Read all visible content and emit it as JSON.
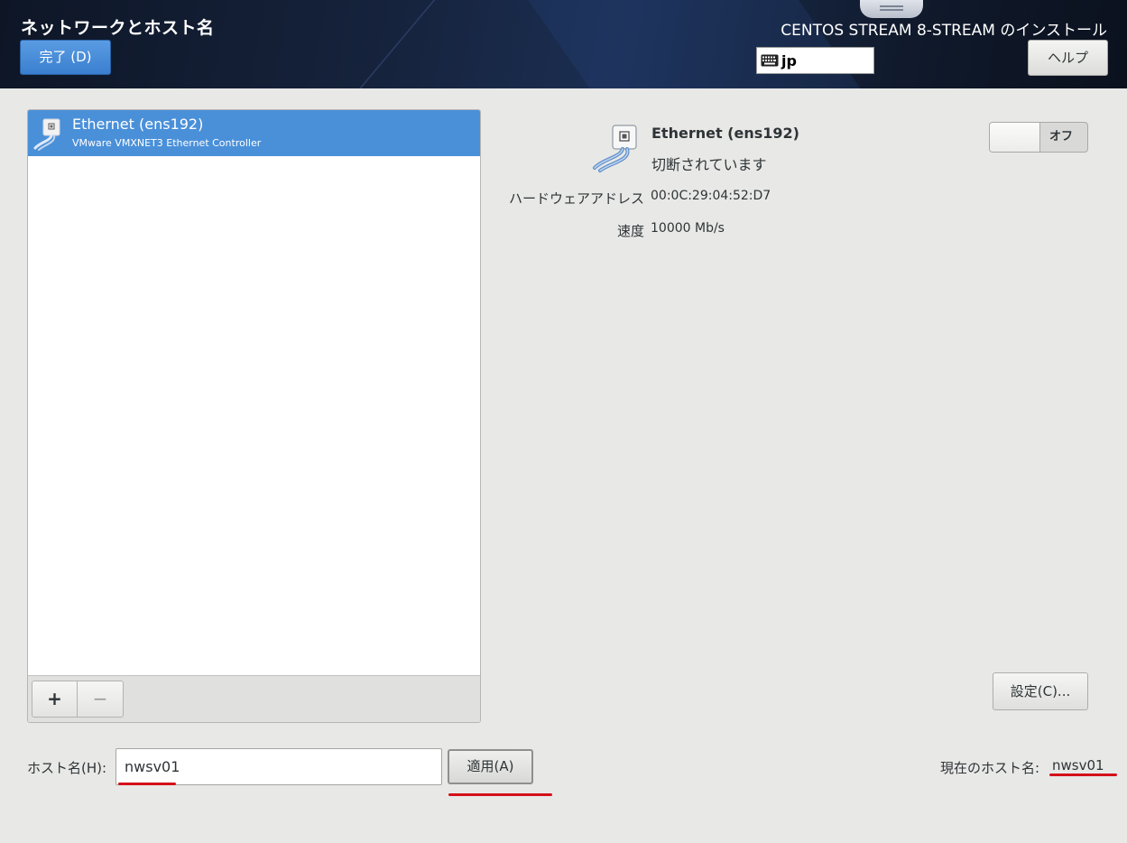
{
  "header": {
    "page_title": "ネットワークとホスト名",
    "done_button": "完了 (D)",
    "install_title": "CENTOS STREAM 8-STREAM のインストール",
    "keyboard_layout": "jp",
    "help_button": "ヘルプ"
  },
  "device_list": {
    "items": [
      {
        "name": "Ethernet (ens192)",
        "description": "VMware VMXNET3 Ethernet Controller",
        "icon": "network-wired-icon",
        "selected": true
      }
    ],
    "add_button": "+",
    "remove_button": "−"
  },
  "details": {
    "name": "Ethernet (ens192)",
    "status": "切断されています",
    "hardware_address_label": "ハードウェアアドレス",
    "hardware_address": "00:0C:29:04:52:D7",
    "speed_label": "速度",
    "speed": "10000 Mb/s",
    "toggle_label": "オフ",
    "toggle_on": false,
    "settings_button": "設定(C)..."
  },
  "hostname": {
    "label": "ホスト名(H):",
    "value": "nwsv01",
    "apply_button": "適用(A)",
    "current_label": "現在のホスト名:",
    "current_value": "nwsv01"
  },
  "colors": {
    "accent": "#4a90d9",
    "highlight_underline": "#d4101a"
  }
}
